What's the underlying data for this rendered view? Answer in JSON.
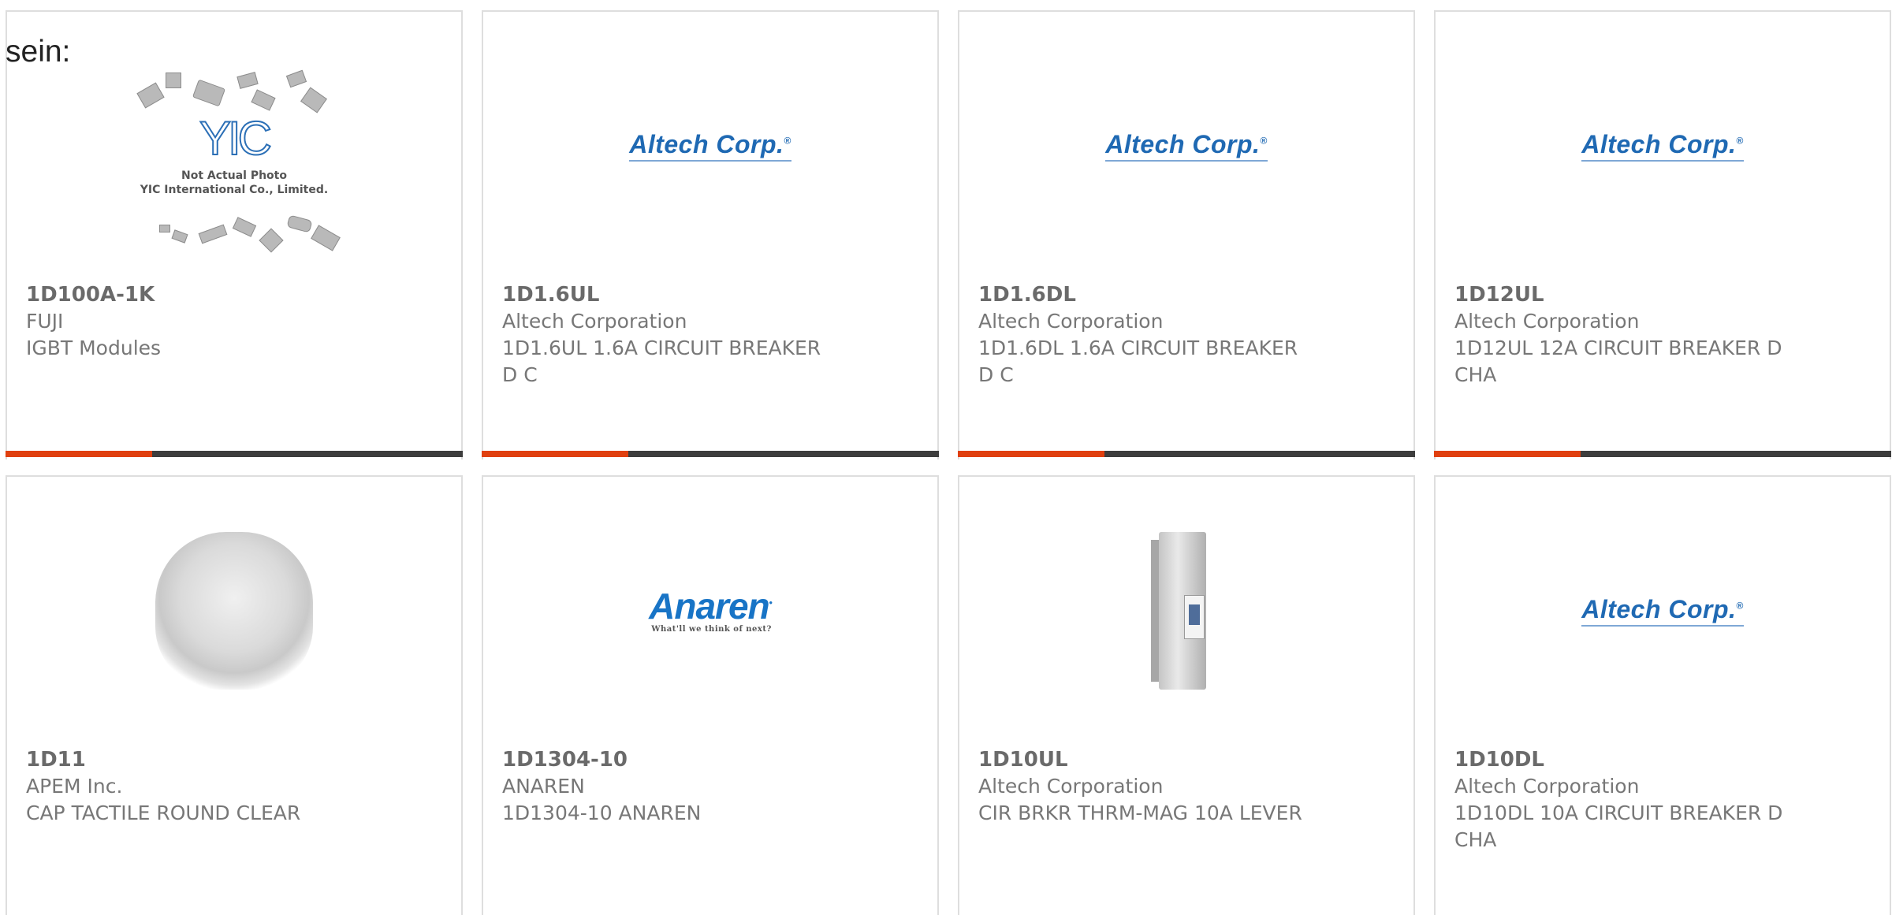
{
  "header": {
    "fragment": "sein:"
  },
  "products": [
    {
      "part_number": "1D100A-1K",
      "manufacturer": "FUJI",
      "description": "IGBT Modules",
      "image": {
        "type": "yic-placeholder",
        "logo_text": "YIC",
        "note_line1": "Not Actual Photo",
        "note_line2": "YIC International Co., Limited."
      },
      "bar_progress": 0.32
    },
    {
      "part_number": "1D1.6UL",
      "manufacturer": "Altech Corporation",
      "description": "1D1.6UL 1.6A CIRCUIT BREAKER D C",
      "image": {
        "type": "logo",
        "logo_text": "Altech Corp.",
        "color": "#1f69b3"
      },
      "bar_progress": 0.32
    },
    {
      "part_number": "1D1.6DL",
      "manufacturer": "Altech Corporation",
      "description": "1D1.6DL 1.6A CIRCUIT BREAKER D C",
      "image": {
        "type": "logo",
        "logo_text": "Altech Corp.",
        "color": "#1f69b3"
      },
      "bar_progress": 0.32
    },
    {
      "part_number": "1D12UL",
      "manufacturer": "Altech Corporation",
      "description": "1D12UL 12A CIRCUIT BREAKER D CHA",
      "image": {
        "type": "logo",
        "logo_text": "Altech Corp.",
        "color": "#1f69b3"
      },
      "bar_progress": 0.32
    },
    {
      "part_number": "1D11",
      "manufacturer": "APEM Inc.",
      "description": "CAP TACTILE ROUND CLEAR",
      "image": {
        "type": "photo-cap"
      }
    },
    {
      "part_number": "1D1304-10",
      "manufacturer": "ANAREN",
      "description": "1D1304-10 ANAREN",
      "image": {
        "type": "logo",
        "logo_text": "Anaren",
        "tagline": "What'll we think of next?",
        "color": "#1874c6"
      }
    },
    {
      "part_number": "1D10UL",
      "manufacturer": "Altech Corporation",
      "description": "CIR BRKR THRM-MAG 10A LEVER",
      "image": {
        "type": "photo-breaker"
      }
    },
    {
      "part_number": "1D10DL",
      "manufacturer": "Altech Corporation",
      "description": "1D10DL 10A CIRCUIT BREAKER D CHA",
      "image": {
        "type": "logo",
        "logo_text": "Altech Corp.",
        "color": "#1f69b3"
      }
    }
  ],
  "colors": {
    "bar_accent": "#e0400f",
    "bar_track": "#3d3d3d",
    "card_border": "#dedede",
    "text_gray": "#777777"
  }
}
